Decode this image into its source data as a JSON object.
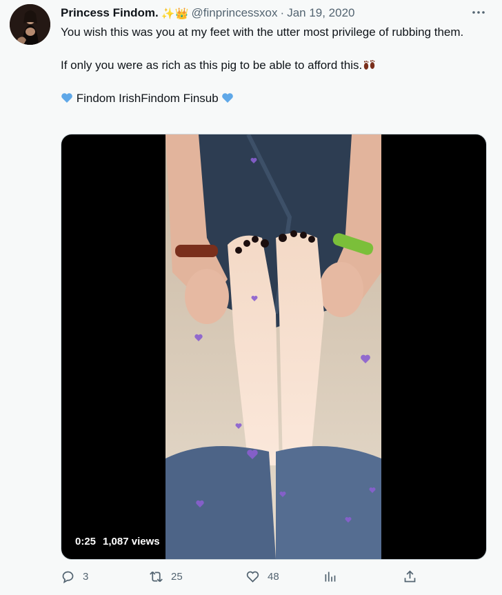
{
  "tweet": {
    "author_name": "Princess Findom.",
    "author_emojis": "✨👑",
    "handle": "@finprincessxox",
    "separator": "·",
    "date": "Jan 19, 2020",
    "line1": "You wish this was you at my feet with the utter most privilege of rubbing them.",
    "line2": "If only you were as rich as this pig to be able to afford this.",
    "tags": "Findom IrishFindom Finsub"
  },
  "media": {
    "duration": "0:25",
    "views": "1,087 views"
  },
  "actions": {
    "replies": "3",
    "retweets": "25",
    "likes": "48"
  },
  "colors": {
    "muted": "#536471",
    "heart_blue": "#5fa8e8",
    "hearts_overlay": "#8a5fd0"
  }
}
